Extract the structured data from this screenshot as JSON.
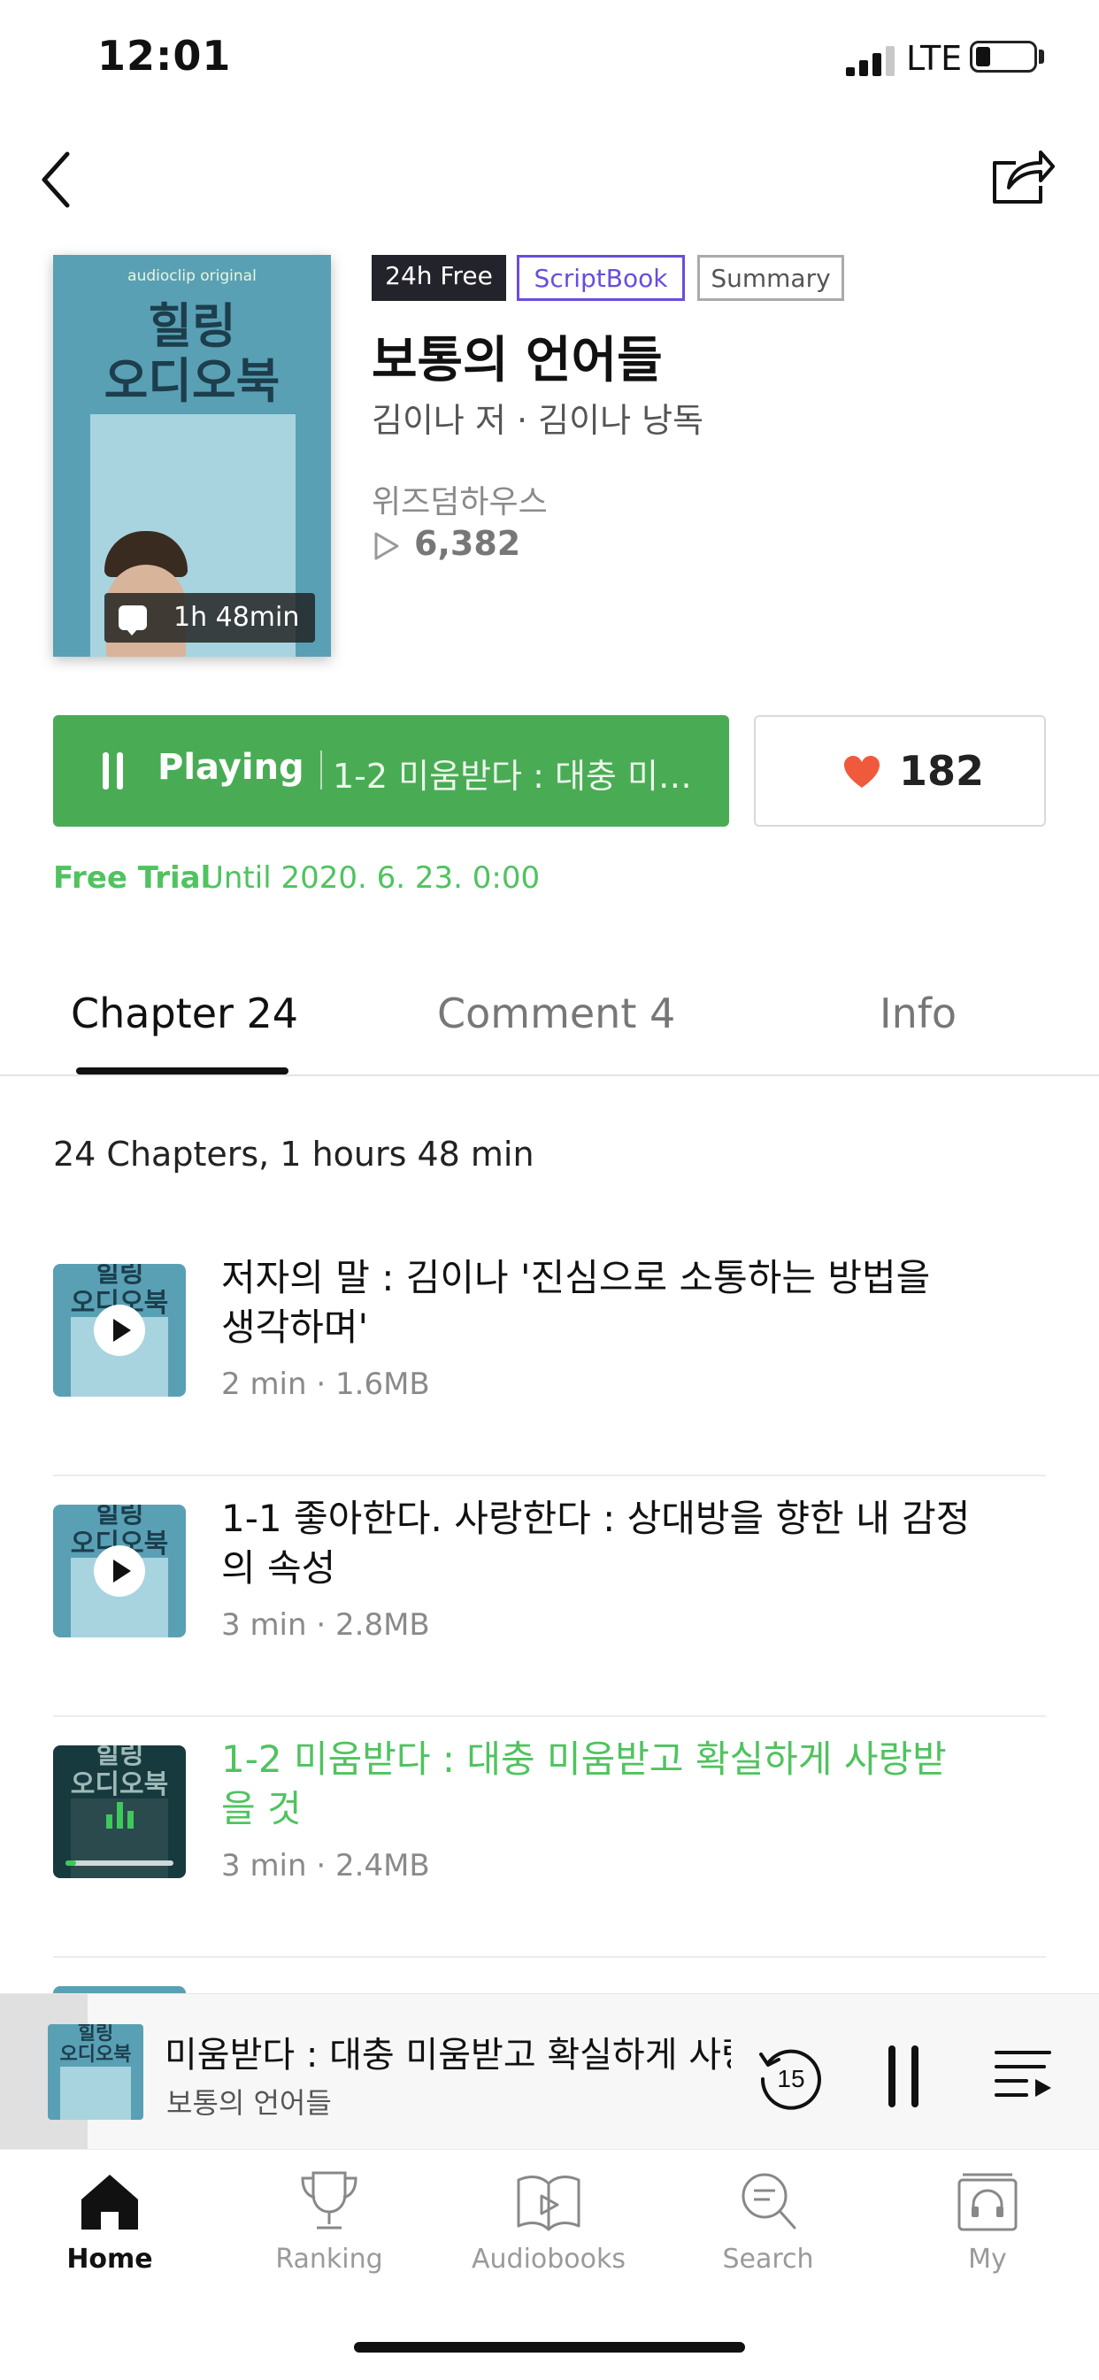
{
  "status": {
    "time": "12:01",
    "network": "LTE"
  },
  "book": {
    "tags": [
      "24h Free",
      "ScriptBook",
      "Summary"
    ],
    "title": "보통의 언어들",
    "author": "김이나 저 · 김이나 낭독",
    "publisher": "위즈덤하우스",
    "play_count": "6,382",
    "duration": "1h 48min",
    "cover": {
      "brand": "audioclip original",
      "title_line1": "힐링",
      "title_line2": "오디오북"
    }
  },
  "player_button": {
    "label": "Playing",
    "track": "1-2 미움받다 : 대충 미…"
  },
  "likes": {
    "count": "182"
  },
  "trial": {
    "label": "Free Trial",
    "until": "Until 2020. 6. 23. 0:00"
  },
  "tabs": [
    {
      "label": "Chapter 24",
      "active": true
    },
    {
      "label": "Comment 4",
      "active": false
    },
    {
      "label": "Info",
      "active": false
    }
  ],
  "chapter_summary": "24 Chapters, 1 hours 48 min",
  "chapters": [
    {
      "title": "저자의 말 : 김이나 '진심으로 소통하는 방법을 생각하며'",
      "duration": "2 min",
      "size": "1.6MB",
      "state": "play"
    },
    {
      "title": "1-1 좋아한다. 사랑한다 : 상대방을 향한 내 감정의 속성",
      "duration": "3 min",
      "size": "2.8MB",
      "state": "play"
    },
    {
      "title": "1-2 미움받다 : 대충 미움받고 확실하게 사랑받을 것",
      "duration": "3 min",
      "size": "2.4MB",
      "state": "playing",
      "progress": 0.1
    }
  ],
  "mini_player": {
    "title": "미움받다 : 대충 미움받고 확실하게 사랑",
    "subtitle": "보통의 언어들",
    "rewind_seconds": "15",
    "progress": 0.08
  },
  "tabbar": [
    {
      "label": "Home",
      "icon": "home-icon",
      "active": true
    },
    {
      "label": "Ranking",
      "icon": "trophy-icon",
      "active": false
    },
    {
      "label": "Audiobooks",
      "icon": "book-icon",
      "active": false
    },
    {
      "label": "Search",
      "icon": "search-icon",
      "active": false
    },
    {
      "label": "My",
      "icon": "headphones-icon",
      "active": false
    }
  ],
  "colors": {
    "accent_green": "#4aab55",
    "active_text": "#4fc35f",
    "script_purple": "#6a4ddc",
    "heart": "#ef5a3c"
  }
}
